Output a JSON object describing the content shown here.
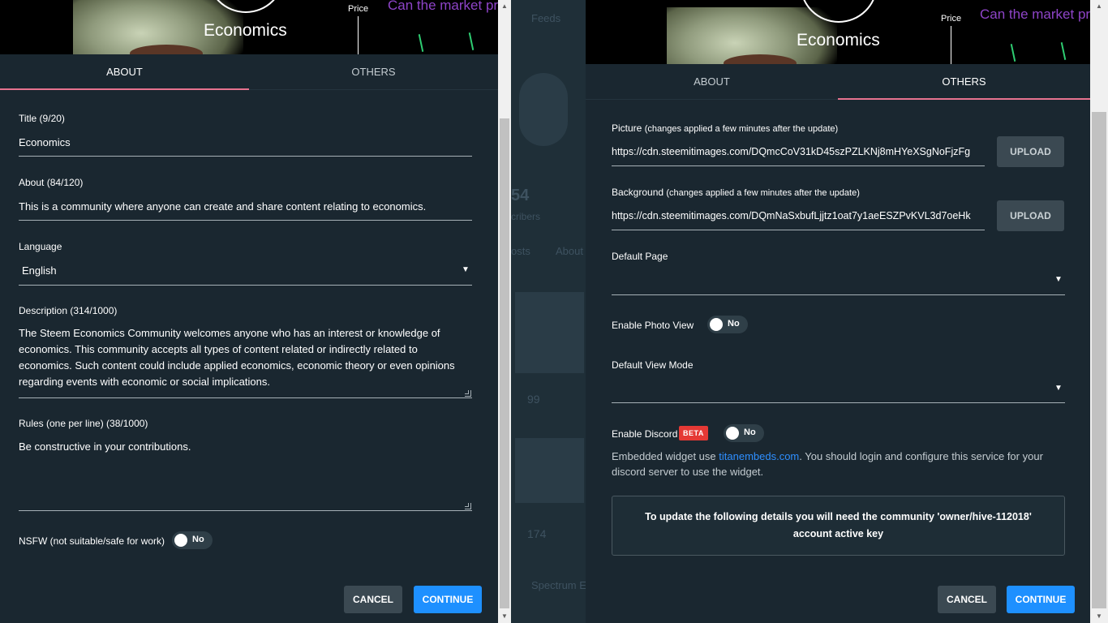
{
  "banner": {
    "community_name": "Economics",
    "price_label": "Price",
    "market_text": "Can the market pr"
  },
  "left_dialog": {
    "tabs": [
      {
        "label": "ABOUT",
        "active": true
      },
      {
        "label": "OTHERS",
        "active": false
      }
    ],
    "title": {
      "label": "Title (9/20)",
      "value": "Economics"
    },
    "about": {
      "label": "About (84/120)",
      "value": "This is a community where anyone can create and share content relating to economics."
    },
    "language": {
      "label": "Language",
      "value": "English"
    },
    "description": {
      "label": "Description (314/1000)",
      "value": "The Steem Economics Community welcomes anyone who has an interest or knowledge of economics. This community accepts all types of content related or indirectly related to economics. Such content could include applied economics, economic theory or even opinions regarding events with economic or social implications."
    },
    "rules": {
      "label": "Rules (one per line) (38/1000)",
      "value": "Be constructive in your contributions."
    },
    "nsfw": {
      "label": "NSFW (not suitable/safe for work)",
      "toggle": "No"
    },
    "cancel_label": "CANCEL",
    "continue_label": "CONTINUE"
  },
  "right_dialog": {
    "tabs": [
      {
        "label": "ABOUT",
        "active": false
      },
      {
        "label": "OTHERS",
        "active": true
      }
    ],
    "picture": {
      "label": "Picture",
      "note": "(changes applied a few minutes after the update)",
      "value": "https://cdn.steemitimages.com/DQmcCoV31kD45szPZLKNj8mHYeXSgNoFjzFg",
      "upload_label": "UPLOAD"
    },
    "background": {
      "label": "Background",
      "note": "(changes applied a few minutes after the update)",
      "value": "https://cdn.steemitimages.com/DQmNaSxbufLjjtz1oat7y1aeESZPvKVL3d7oeHk",
      "upload_label": "UPLOAD"
    },
    "default_page": {
      "label": "Default Page",
      "value": ""
    },
    "photo_view": {
      "label": "Enable Photo View",
      "toggle": "No"
    },
    "default_view_mode": {
      "label": "Default View Mode",
      "value": ""
    },
    "discord": {
      "label": "Enable Discord",
      "badge": "BETA",
      "toggle": "No",
      "help_prefix": "Embedded widget use ",
      "help_link": "titanembeds.com",
      "help_suffix": ". You should login and configure this service for your discord server to use the widget."
    },
    "notice": "To update the following details you will need the community 'owner/hive-112018' account active key",
    "cancel_label": "CANCEL",
    "continue_label": "CONTINUE"
  },
  "backdrop": {
    "feeds_label": "Feeds",
    "subscriber_count": "54",
    "subscribers_label": "cribers",
    "tab_posts": "osts",
    "tab_about": "About",
    "vote_count_1": "99",
    "vote_count_2": "174",
    "community_label": "Spectrum E"
  },
  "colors": {
    "panel_bg": "#1a2730",
    "tab_indicator": "#e7738f",
    "primary_button": "#1e90ff",
    "secondary_button": "#3b4952",
    "beta_badge": "#e53935",
    "link": "#2e8fff",
    "market_text": "#8e44c8"
  }
}
